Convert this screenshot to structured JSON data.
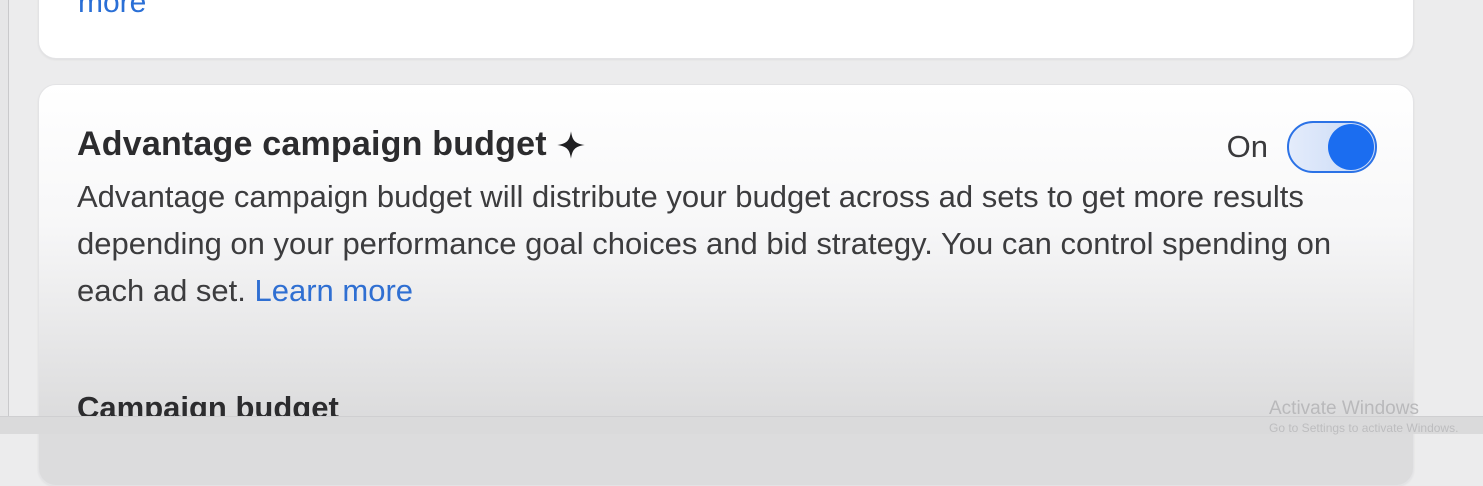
{
  "previous_card": {
    "more_link_label": "more"
  },
  "advantage_campaign_budget": {
    "title": "Advantage campaign budget",
    "title_icon": "sparkle-icon",
    "toggle": {
      "label": "On",
      "state": "on",
      "accent_color": "#1b6df0"
    },
    "description": "Advantage campaign budget will distribute your budget across ad sets to get more results depending on your performance goal choices and bid strategy. You can control spending on each ad set.",
    "learn_more_label": "Learn more",
    "campaign_budget_heading": "Campaign budget"
  },
  "os_watermark": {
    "title": "Activate Windows",
    "subtitle": "Go to Settings to activate Windows."
  }
}
